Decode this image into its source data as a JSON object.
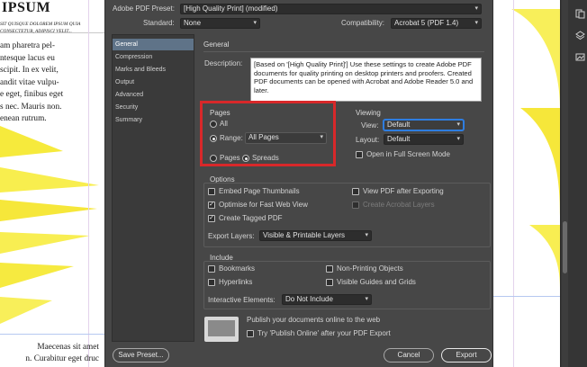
{
  "background_doc": {
    "title": "IPSUM",
    "subtitle_lines": [
      "SIT QUISQUE DOLOREM IPSUM QUIA",
      "CONSECTETUR, ADIPISCI VELIT..."
    ],
    "paragraph_lines": [
      "am pharetra pel-",
      "ntesque lacus eu",
      "scipit. In ex velit,",
      "andit vitae vulpu-",
      "e eget, finibus eget",
      "s nec. Mauris non.",
      "enean rutrum."
    ],
    "paragraph2_lines": [
      "Maecenas sit amet",
      "n. Curabitur eget druc"
    ]
  },
  "dialog": {
    "preset_label": "Adobe PDF Preset:",
    "preset_value": "[High Quality Print] (modified)",
    "standard_label": "Standard:",
    "standard_value": "None",
    "compatibility_label": "Compatibility:",
    "compatibility_value": "Acrobat 5 (PDF 1.4)",
    "sidebar": [
      "General",
      "Compression",
      "Marks and Bleeds",
      "Output",
      "Advanced",
      "Security",
      "Summary"
    ],
    "section_title": "General",
    "description_label": "Description:",
    "description_text": "[Based on '[High Quality Print]'] Use these settings to create Adobe PDF documents for quality printing on desktop printers and proofers.  Created PDF documents can be opened with Acrobat and Adobe Reader 5.0 and later.",
    "pages": {
      "title": "Pages",
      "all_label": "All",
      "range_label": "Range:",
      "range_value": "All Pages",
      "pages_label": "Pages",
      "spreads_label": "Spreads"
    },
    "viewing": {
      "title": "Viewing",
      "view_label": "View:",
      "view_value": "Default",
      "layout_label": "Layout:",
      "layout_value": "Default",
      "fullscreen_label": "Open in Full Screen Mode"
    },
    "options": {
      "title": "Options",
      "embed_thumbs": "Embed Page Thumbnails",
      "view_after": "View PDF after Exporting",
      "optimise": "Optimise for Fast Web View",
      "acrobat_layers": "Create Acrobat Layers",
      "tagged_pdf": "Create Tagged PDF",
      "export_layers_label": "Export Layers:",
      "export_layers_value": "Visible & Printable Layers"
    },
    "include": {
      "title": "Include",
      "bookmarks": "Bookmarks",
      "nonprinting": "Non-Printing Objects",
      "hyperlinks": "Hyperlinks",
      "visible_guides": "Visible Guides and Grids",
      "interactive_label": "Interactive Elements:",
      "interactive_value": "Do Not Include"
    },
    "publish": {
      "headline": "Publish your documents online to the web",
      "try_label": "Try 'Publish Online' after your PDF Export"
    },
    "buttons": {
      "save_preset": "Save Preset...",
      "cancel": "Cancel",
      "export": "Export"
    }
  },
  "colors": {
    "highlight_box": "#d8282a",
    "selected_sidebar": "#5f7388",
    "yellow_art": "#f7ec3a"
  }
}
